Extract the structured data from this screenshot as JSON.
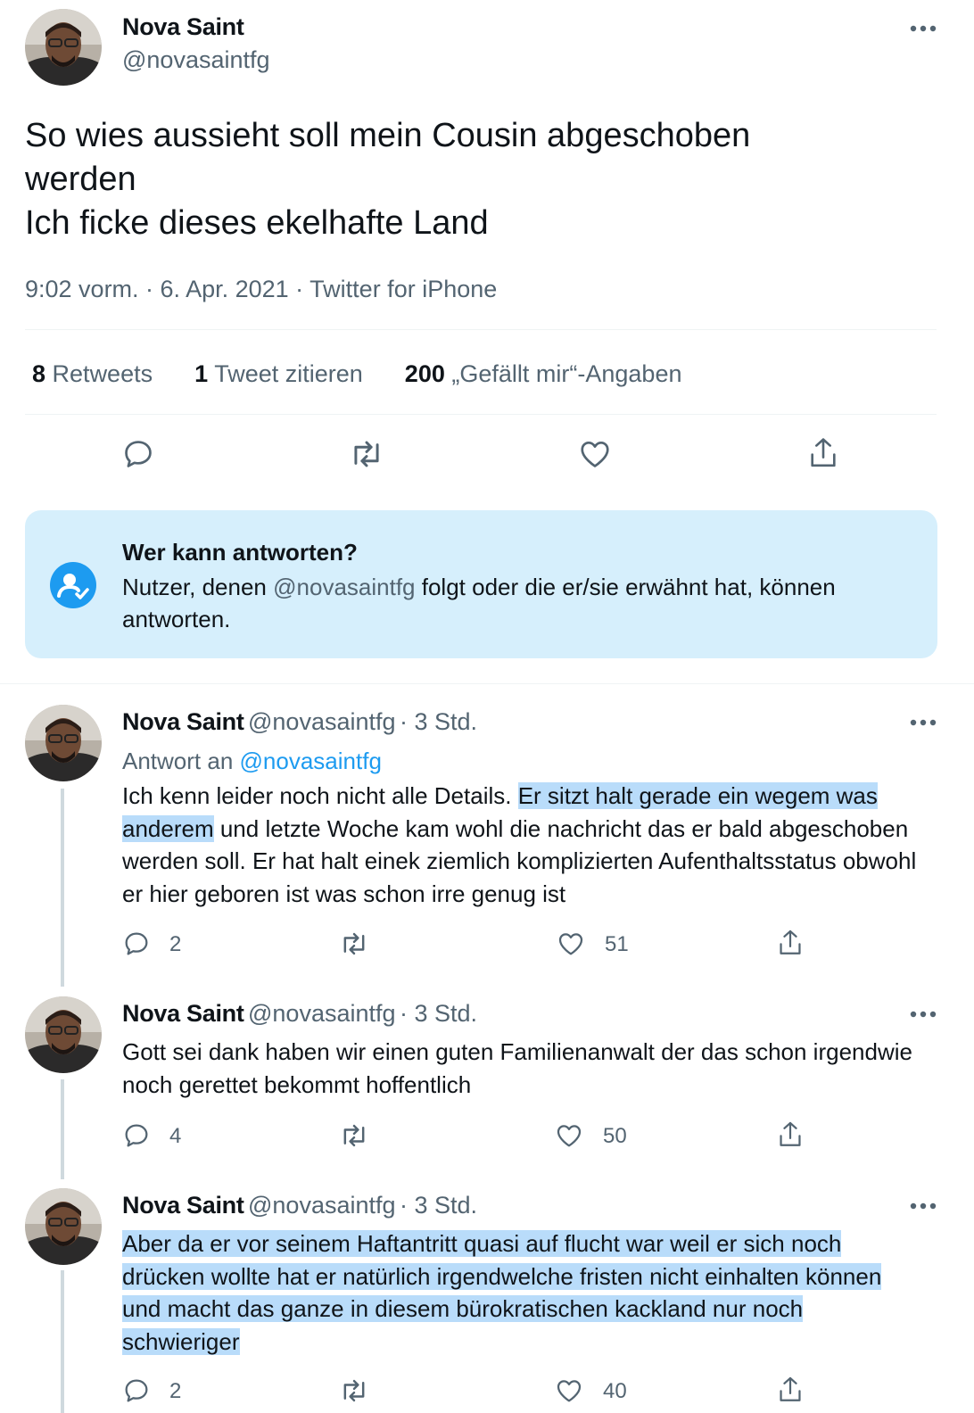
{
  "main_tweet": {
    "author_name": "Nova Saint",
    "author_handle": "@novasaintfg",
    "text_line1": "So wies aussieht soll mein Cousin abgeschoben",
    "text_line2": "werden",
    "text_line3": "Ich ficke dieses ekelhafte Land",
    "timestamp": "9:02 vorm. · 6. Apr. 2021 · Twitter for iPhone",
    "stats": {
      "retweets_count": "8",
      "retweets_label": "Retweets",
      "quotes_count": "1",
      "quotes_label": "Tweet zitieren",
      "likes_count": "200",
      "likes_label": "„Gefällt mir“-Angaben"
    }
  },
  "reply_restriction": {
    "title": "Wer kann antworten?",
    "text_before": "Nutzer, denen ",
    "mention": "@novasaintfg",
    "text_after": " folgt oder die er/sie erwähnt hat, können antworten."
  },
  "replies": [
    {
      "author_name": "Nova Saint",
      "author_handle": "@novasaintfg",
      "time": "· 3 Std.",
      "reply_to_label": "Antwort an",
      "reply_to_handle": "@novasaintfg",
      "text_plain_1": "Ich kenn leider noch nicht alle Details. ",
      "text_highlight_1": "Er sitzt halt gerade ein wegem was anderem",
      "text_plain_2": " und letzte Woche kam wohl die nachricht das er bald abgeschoben werden soll. Er hat halt einek ziemlich komplizierten Aufenthaltsstatus obwohl er hier geboren ist was schon irre genug ist",
      "reply_count": "2",
      "retweet_count": "",
      "like_count": "51"
    },
    {
      "author_name": "Nova Saint",
      "author_handle": "@novasaintfg",
      "time": "· 3 Std.",
      "text": "Gott sei dank haben wir einen guten Familienanwalt der das schon irgendwie noch gerettet bekommt hoffentlich",
      "reply_count": "4",
      "retweet_count": "",
      "like_count": "50"
    },
    {
      "author_name": "Nova Saint",
      "author_handle": "@novasaintfg",
      "time": "· 3 Std.",
      "text_highlight": "Aber da er vor seinem Haftantritt quasi auf flucht war weil er sich noch drücken wollte hat er natürlich irgendwelche fristen nicht einhalten können und macht das ganze in diesem bürokratischen kackland nur noch schwieriger",
      "reply_count": "2",
      "retweet_count": "",
      "like_count": "40"
    }
  ],
  "icons": {
    "reply": "reply-icon",
    "retweet": "retweet-icon",
    "like": "heart-icon",
    "share": "share-icon",
    "more": "more-icon",
    "restriction": "user-check-icon"
  },
  "colors": {
    "link": "#1d9bf0",
    "secondary_text": "#536471",
    "highlight": "#b9dcfa",
    "notice_bg": "#d6effc"
  }
}
